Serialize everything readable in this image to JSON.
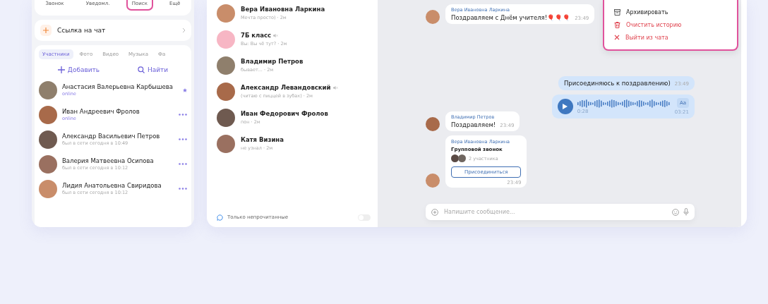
{
  "top_actions": [
    {
      "label": "Звонок",
      "selected": false
    },
    {
      "label": "Уведомл.",
      "selected": false
    },
    {
      "label": "Поиск",
      "selected": true
    },
    {
      "label": "Ещё",
      "selected": false
    }
  ],
  "chat_link": {
    "label": "Ссылка на чат"
  },
  "member_tabs": [
    {
      "label": "Участники",
      "selected": true
    },
    {
      "label": "Фото",
      "selected": false
    },
    {
      "label": "Видео",
      "selected": false
    },
    {
      "label": "Музыка",
      "selected": false
    },
    {
      "label": "Фа",
      "selected": false
    }
  ],
  "member_actions": [
    {
      "label": "Добавить",
      "kind": "add"
    },
    {
      "label": "Найти",
      "kind": "search"
    }
  ],
  "members": [
    {
      "name": "Анастасия Валерьевна Карбышева",
      "status": "online",
      "online": true,
      "kind": "starred"
    },
    {
      "name": "Иван Андреевич Фролов",
      "status": "online",
      "online": true,
      "kind": "more"
    },
    {
      "name": "Александр Васильевич Петров",
      "status": "был в сети сегодня в 10:49",
      "online": false,
      "kind": "more"
    },
    {
      "name": "Валерия Матвеевна Осипова",
      "status": "был в сети сегодня в 10:12",
      "online": false,
      "kind": "more"
    },
    {
      "name": "Лидия Анатольевна Свиридова",
      "status": "был в сети сегодня в 10:12",
      "online": false,
      "kind": "more"
    }
  ],
  "chats": [
    {
      "name": "Вера Ивановна Ларкина",
      "preview": "Мечта просто) · 2м",
      "muted": false,
      "kind": "person"
    },
    {
      "name": "7Б класс",
      "preview": "Вы: Вы чё тут? · 2м",
      "muted": true,
      "kind": "group"
    },
    {
      "name": "Владимир Петров",
      "preview": "бывает... · 2м",
      "muted": false,
      "kind": "person"
    },
    {
      "name": "Александр Левандовский",
      "preview": "(читаю с пиццей в зубах) · 2м",
      "muted": true,
      "kind": "person"
    },
    {
      "name": "Иван Федорович Фролов",
      "preview": "пон · 2м",
      "muted": false,
      "kind": "person"
    },
    {
      "name": "Катя Визина",
      "preview": "не узнал · 2м",
      "muted": false,
      "kind": "person"
    }
  ],
  "unread_filter": {
    "label": "Только непрочитанные",
    "on": false
  },
  "messages": [
    {
      "kind": "incoming",
      "author": "Вера Ивановна Ларкина",
      "text": "Поздравляем с Днём учителя!🎈🎈🎈",
      "time": "23:49"
    },
    {
      "kind": "outgoing",
      "text": "Присоединяюсь к поздравлению)",
      "time": "23:49"
    },
    {
      "kind": "voice",
      "duration": "0:28",
      "total": "03:21",
      "transcribe": "Аа"
    },
    {
      "kind": "incoming",
      "author": "Владимир Петров",
      "text": "Поздравляем!",
      "time": "23:49"
    },
    {
      "kind": "call",
      "author": "Вера Ивановна Ларкина",
      "title": "Групповой звонок",
      "participants": "2 участника",
      "button": "Присоединиться",
      "time": "23:49"
    }
  ],
  "composer": {
    "placeholder": "Напишите сообщение..."
  },
  "menu": {
    "items": [
      {
        "label": "Архивировать",
        "kind": "archive"
      },
      {
        "label": "Очистить историю",
        "kind": "clear"
      },
      {
        "label": "Выйти из чата",
        "kind": "leave"
      }
    ]
  }
}
